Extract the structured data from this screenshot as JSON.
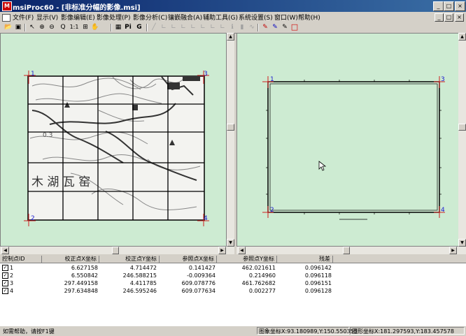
{
  "window": {
    "app_icon_text": "M",
    "title": "msiProc60 - [非标准分幅的影像.msi]",
    "outer_controls": [
      "_",
      "□",
      "×"
    ],
    "inner_controls": [
      "_",
      "□",
      "×"
    ]
  },
  "menu": [
    "文件(F)",
    "显示(V)",
    "影像编辑(E)",
    "影像处理(P)",
    "影像分析(C)",
    "镶嵌融合(A)",
    "辅助工具(G)",
    "系统设置(S)",
    "窗口(W)",
    "帮助(H)"
  ],
  "toolbar": [
    {
      "icon": "open-folder-icon",
      "glyph": "📂",
      "enabled": true
    },
    {
      "icon": "save-icon",
      "glyph": "▣",
      "enabled": true
    },
    {
      "icon": "pointer-icon",
      "glyph": "↖",
      "enabled": true
    },
    {
      "icon": "zoom-in-icon",
      "glyph": "⊕",
      "enabled": true
    },
    {
      "icon": "zoom-out-icon",
      "glyph": "⊖",
      "enabled": true
    },
    {
      "icon": "zoom-icon",
      "glyph": "Q",
      "enabled": true
    },
    {
      "icon": "actual-size-icon",
      "glyph": "1:1",
      "enabled": true
    },
    {
      "icon": "zoom-fit-icon",
      "glyph": "⊞",
      "enabled": true
    },
    {
      "icon": "pan-hand-icon",
      "glyph": "✋",
      "enabled": true
    },
    {
      "icon": "properties-icon",
      "glyph": "▦",
      "enabled": true
    },
    {
      "icon": "control-point-icon",
      "glyph": "Pi",
      "enabled": true
    },
    {
      "icon": "geo-icon",
      "glyph": "G",
      "enabled": true
    },
    {
      "icon": "draw-line-icon",
      "glyph": "╱",
      "enabled": false
    },
    {
      "icon": "draw-corner-icon",
      "glyph": "∟",
      "enabled": false
    },
    {
      "icon": "draw-corner-icon",
      "glyph": "∟",
      "enabled": false
    },
    {
      "icon": "draw-corner-icon",
      "glyph": "∟",
      "enabled": false
    },
    {
      "icon": "draw-corner-icon",
      "glyph": "∟",
      "enabled": false
    },
    {
      "icon": "draw-corner-icon",
      "glyph": "∟",
      "enabled": false
    },
    {
      "icon": "draw-corner-icon",
      "glyph": "∟",
      "enabled": false
    },
    {
      "icon": "draw-corner-icon",
      "glyph": "∟",
      "enabled": false
    },
    {
      "icon": "info-icon",
      "glyph": "ℹ",
      "enabled": false
    },
    {
      "icon": "histogram-icon",
      "glyph": "▮",
      "enabled": false
    },
    {
      "icon": "curve-icon",
      "glyph": "∿",
      "enabled": false
    },
    {
      "icon": "pencil-red-icon",
      "glyph": "✎",
      "enabled": true
    },
    {
      "icon": "pencil-blue-icon",
      "glyph": "✎",
      "enabled": true
    },
    {
      "icon": "pencil-icon",
      "glyph": "✎",
      "enabled": true
    },
    {
      "icon": "rectangle-red-icon",
      "glyph": "□",
      "enabled": true
    }
  ],
  "left_view": {
    "corner_labels": [
      "1",
      "3",
      "2",
      "4"
    ],
    "map_text_village": "木 湖 瓦 窑",
    "map_text_elev": "0.3"
  },
  "right_view": {
    "corner_labels": [
      "1",
      "3",
      "2",
      "4"
    ]
  },
  "table": {
    "headers": [
      "控制点ID",
      "校正点X坐标",
      "校正点Y坐标",
      "参照点X坐标",
      "参照点Y坐标",
      "残差"
    ],
    "rows": [
      {
        "id": "1",
        "cx": "6.627158",
        "cy": "4.714472",
        "rx": "0.141427",
        "ry": "462.021611",
        "res": "0.096142"
      },
      {
        "id": "2",
        "cx": "6.550842",
        "cy": "246.588215",
        "rx": "-0.009364",
        "ry": "0.214960",
        "res": "0.096118"
      },
      {
        "id": "3",
        "cx": "297.449158",
        "cy": "4.411785",
        "rx": "609.078776",
        "ry": "461.762682",
        "res": "0.096151"
      },
      {
        "id": "4",
        "cx": "297.634848",
        "cy": "246.595246",
        "rx": "609.077634",
        "ry": "0.002277",
        "res": "0.096128"
      }
    ]
  },
  "status": {
    "help": "如需帮助，请按F1键",
    "image_coord": "图象坐标X:93.180989,Y:150.550353",
    "figure_coord": "图形坐标X:181.297593,Y:183.457578"
  },
  "colors": {
    "pane_bg": "#cdebd2",
    "title_start": "#0a246a",
    "title_end": "#3a6ea5",
    "marker_red": "#d02020",
    "marker_blue": "#1a1ad0"
  }
}
